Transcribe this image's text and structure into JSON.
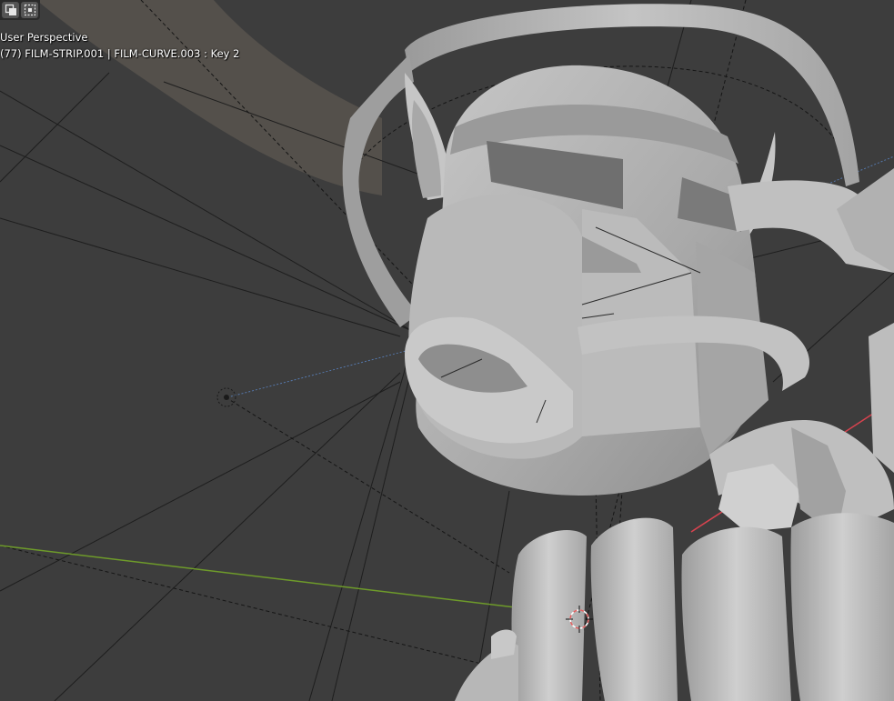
{
  "viewport": {
    "perspective_label": "User Perspective",
    "object_info": "(77) FILM-STRIP.001 | FILM-CURVE.003 : Key 2"
  },
  "toolbar": {
    "mode_buttons": [
      {
        "icon": "select-box-icon",
        "active": false
      },
      {
        "icon": "select-extend-icon",
        "active": false
      }
    ]
  },
  "colors": {
    "background": "#3d3d3d",
    "mesh": "#b4b4b4",
    "x_axis": "#d8434f",
    "y_axis": "#6e9b2a",
    "cursor_red": "#e06060"
  }
}
